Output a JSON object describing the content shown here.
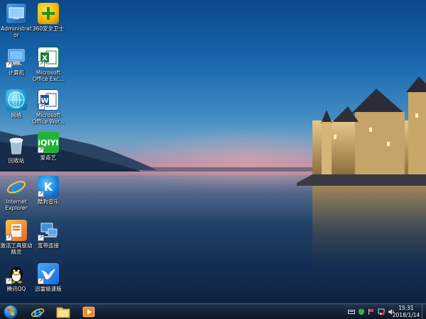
{
  "desktop": {
    "icons": [
      {
        "label": "Administrator"
      },
      {
        "label": "360安全卫士"
      },
      {
        "label": "计算机"
      },
      {
        "label": "Microsoft Office Exc..."
      },
      {
        "label": "网络"
      },
      {
        "label": "Microsoft Office Wor..."
      },
      {
        "label": "回收站"
      },
      {
        "label": "爱奇艺",
        "glyph": "iQIYI"
      },
      {
        "label": "Internet Explorer"
      },
      {
        "label": "酷狗音乐",
        "glyph": "K"
      },
      {
        "label": "激活工具驱动精灵"
      },
      {
        "label": "宽带连接"
      },
      {
        "label": "腾讯QQ"
      },
      {
        "label": "迅雷极速版"
      }
    ]
  },
  "taskbar": {
    "clock_time": "15:31",
    "clock_date": "2018/1/14",
    "pinned": [
      "ie-icon",
      "explorer-icon",
      "media-player-icon"
    ]
  },
  "colors": {
    "taskbar": "#142236",
    "sky_top": "#0a4a8a",
    "horizon": "#c98f9a"
  }
}
